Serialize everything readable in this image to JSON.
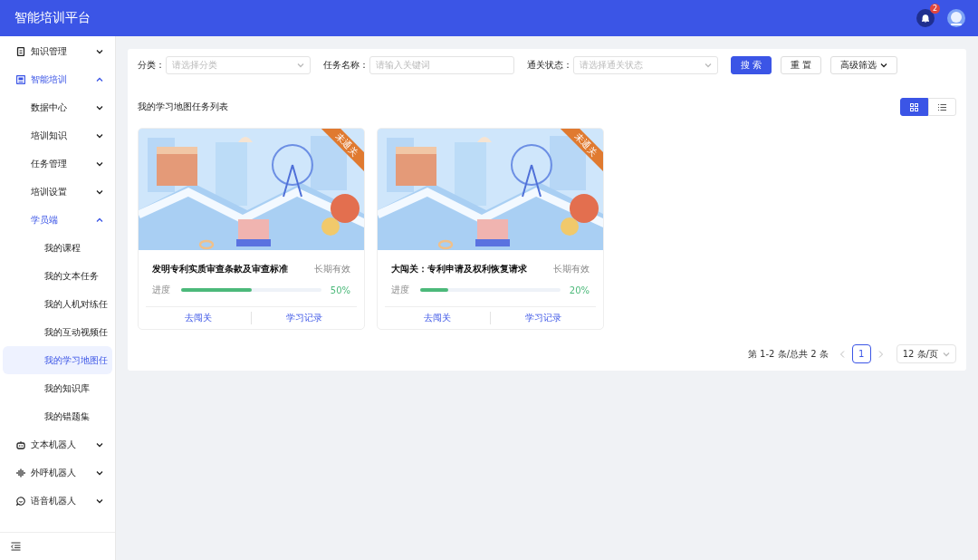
{
  "header": {
    "title": "智能培训平台",
    "notification_count": "2"
  },
  "sidebar": {
    "items": [
      {
        "label": "知识管理",
        "expanded": false,
        "selected": false
      },
      {
        "label": "智能培训",
        "expanded": true,
        "selected": true,
        "children": [
          {
            "label": "数据中心",
            "expanded": false,
            "selected": false
          },
          {
            "label": "培训知识",
            "expanded": false,
            "selected": false
          },
          {
            "label": "任务管理",
            "expanded": false,
            "selected": false
          },
          {
            "label": "培训设置",
            "expanded": false,
            "selected": false
          },
          {
            "label": "学员端",
            "expanded": true,
            "selected": true,
            "children": [
              {
                "label": "我的课程",
                "selected": false
              },
              {
                "label": "我的文本任务",
                "selected": false
              },
              {
                "label": "我的人机对练任",
                "selected": false
              },
              {
                "label": "我的互动视频任",
                "selected": false
              },
              {
                "label": "我的学习地图任",
                "selected": true
              },
              {
                "label": "我的知识库",
                "selected": false
              },
              {
                "label": "我的错题集",
                "selected": false
              }
            ]
          }
        ]
      },
      {
        "label": "文本机器人",
        "expanded": false,
        "selected": false
      },
      {
        "label": "外呼机器人",
        "expanded": false,
        "selected": false
      },
      {
        "label": "语音机器人",
        "expanded": false,
        "selected": false
      }
    ]
  },
  "filters": [
    {
      "label": "分类：",
      "placeholder": "请选择分类",
      "kind": "select"
    },
    {
      "label": "任务名称：",
      "placeholder": "请输入关键词",
      "kind": "input"
    },
    {
      "label": "通关状态：",
      "placeholder": "请选择通关状态",
      "kind": "select"
    }
  ],
  "buttons": [
    {
      "label": "搜 索",
      "kind": "primary"
    },
    {
      "label": "重 置",
      "kind": "default"
    },
    {
      "label": "高级筛选",
      "kind": "dropdown"
    }
  ],
  "list_title": "我的学习地图任务列表",
  "view_toggle": [
    {
      "kind": "grid",
      "selected": true
    },
    {
      "kind": "list",
      "selected": false
    }
  ],
  "cards": [
    {
      "ribbon": "未通关",
      "title": "发明专利实质审查条款及审查标准",
      "validity": "长期有效",
      "progress_label": "进度",
      "level": 0.5,
      "percent": "50%",
      "actions": [
        "去闯关",
        "学习记录"
      ]
    },
    {
      "ribbon": "未通关",
      "title": "大闯关：专利申请及权利恢复请求",
      "validity": "长期有效",
      "progress_label": "进度",
      "level": 0.2,
      "percent": "20%",
      "actions": [
        "去闯关",
        "学习记录"
      ]
    }
  ],
  "pagination": {
    "summary": "第 1-2 条/总共 2 条",
    "pages": [
      {
        "label": "1",
        "selected": true
      }
    ],
    "page_size": "12 条/页"
  }
}
